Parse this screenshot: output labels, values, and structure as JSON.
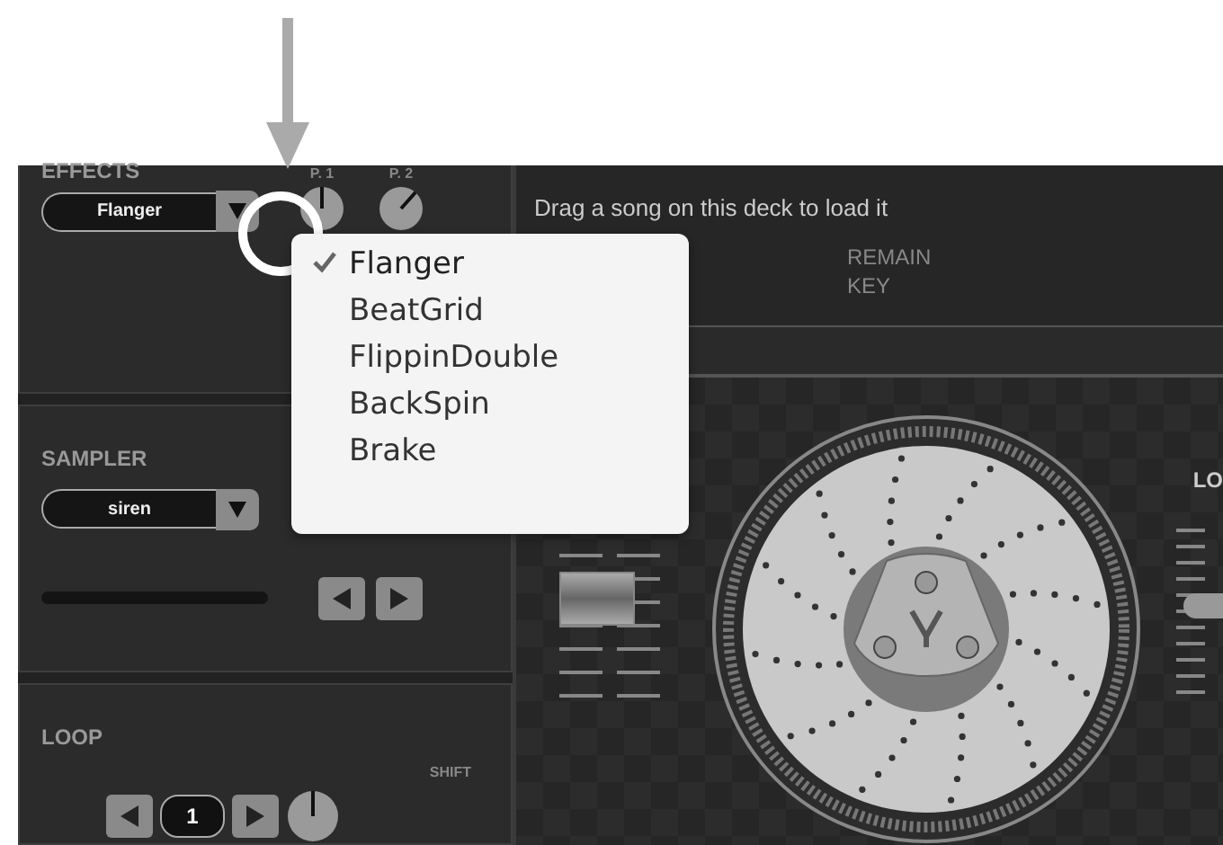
{
  "effects": {
    "label": "EFFECTS",
    "value": "Flanger",
    "knobs": [
      {
        "label": "P. 1"
      },
      {
        "label": "P. 2"
      }
    ]
  },
  "effect_menu": {
    "items": [
      {
        "label": "Flanger",
        "selected": true
      },
      {
        "label": "BeatGrid",
        "selected": false
      },
      {
        "label": "FlippinDouble",
        "selected": false
      },
      {
        "label": "BackSpin",
        "selected": false
      },
      {
        "label": "Brake",
        "selected": false
      }
    ]
  },
  "sampler": {
    "label": "SAMPLER",
    "value": "siren",
    "level": 0
  },
  "loop": {
    "label": "LOOP",
    "value": "1",
    "shift_label": "SHIFT"
  },
  "deck": {
    "message": "Drag a song on this deck to load it",
    "info": [
      "REMAIN",
      "KEY"
    ],
    "side_label": "LO"
  }
}
